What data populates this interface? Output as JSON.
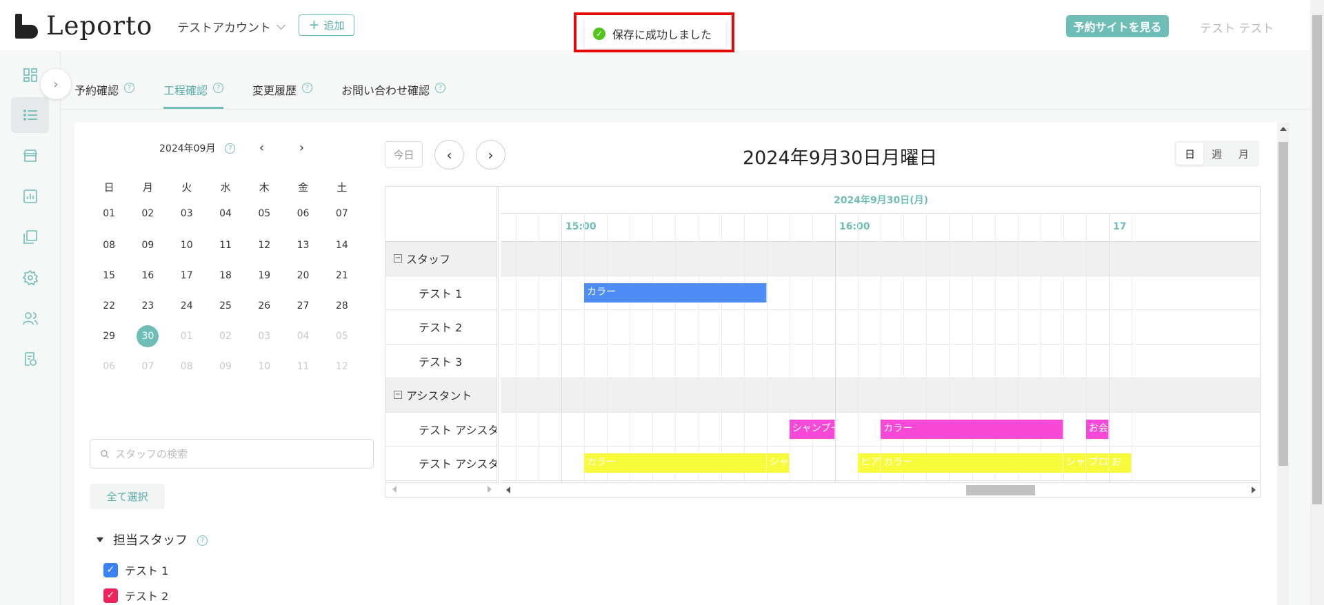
{
  "header": {
    "logo_text": "Leporto",
    "account_name": "テストアカウント",
    "add_label": "追加",
    "toast_message": "保存に成功しました",
    "view_site_label": "予約サイトを見る",
    "user_name": "テスト テスト"
  },
  "sidebar": {
    "items": [
      {
        "icon": "dashboard-icon",
        "active": false
      },
      {
        "icon": "list-icon",
        "active": true
      },
      {
        "icon": "store-icon",
        "active": false
      },
      {
        "icon": "report-chart-icon",
        "active": false
      },
      {
        "icon": "copy-pages-icon",
        "active": false
      },
      {
        "icon": "gear-icon",
        "active": false
      },
      {
        "icon": "users-icon",
        "active": false
      },
      {
        "icon": "invoice-icon",
        "active": false
      }
    ]
  },
  "tabs": [
    {
      "label": "予約確認",
      "active": false
    },
    {
      "label": "工程確認",
      "active": true
    },
    {
      "label": "変更履歴",
      "active": false
    },
    {
      "label": "お問い合わせ確認",
      "active": false
    }
  ],
  "calendar": {
    "month_label": "2024年09月",
    "weekdays": [
      "日",
      "月",
      "火",
      "水",
      "木",
      "金",
      "土"
    ],
    "weeks": [
      [
        "01",
        "02",
        "03",
        "04",
        "05",
        "06",
        "07"
      ],
      [
        "08",
        "09",
        "10",
        "11",
        "12",
        "13",
        "14"
      ],
      [
        "15",
        "16",
        "17",
        "18",
        "19",
        "20",
        "21"
      ],
      [
        "22",
        "23",
        "24",
        "25",
        "26",
        "27",
        "28"
      ],
      [
        "29",
        "30",
        "01",
        "02",
        "03",
        "04",
        "05"
      ],
      [
        "06",
        "07",
        "08",
        "09",
        "10",
        "11",
        "12"
      ]
    ],
    "selected": "30"
  },
  "staff_filter": {
    "search_placeholder": "スタッフの検索",
    "select_all_label": "全て選択",
    "section_title": "担当スタッフ",
    "staff": [
      {
        "name": "テスト 1",
        "color": "#3b82f6",
        "checked": true
      },
      {
        "name": "テスト 2",
        "color": "#f0245c",
        "checked": true
      }
    ]
  },
  "scheduler": {
    "today_label": "今日",
    "title": "2024年9月30日月曜日",
    "views": [
      {
        "label": "日",
        "active": true
      },
      {
        "label": "週",
        "active": false
      },
      {
        "label": "月",
        "active": false
      }
    ],
    "date_header": "2024年9月30日(月)",
    "hours": [
      "15:00",
      "16:00",
      "17"
    ],
    "rows": [
      {
        "label": "スタッフ",
        "group": true
      },
      {
        "label": "テスト 1",
        "group": false
      },
      {
        "label": "テスト 2",
        "group": false
      },
      {
        "label": "テスト 3",
        "group": false
      },
      {
        "label": "アシスタント",
        "group": true
      },
      {
        "label": "テスト アシスタ",
        "group": false
      },
      {
        "label": "テスト アシスタ",
        "group": false
      }
    ],
    "events": [
      {
        "row": 1,
        "start": "15:05",
        "end": "15:45",
        "label": "カラー",
        "color": "blue"
      },
      {
        "row": 5,
        "start": "15:50",
        "end": "16:00",
        "label": "シャンプー",
        "color": "pink"
      },
      {
        "row": 5,
        "start": "16:10",
        "end": "16:50",
        "label": "カラー",
        "color": "pink"
      },
      {
        "row": 5,
        "start": "16:55",
        "end": "17:00",
        "label": "お会計",
        "color": "pink"
      },
      {
        "row": 6,
        "start": "15:05",
        "end": "15:45",
        "label": "カラー",
        "color": "yellow"
      },
      {
        "row": 6,
        "start": "15:45",
        "end": "15:50",
        "label": "シャ",
        "color": "yellow"
      },
      {
        "row": 6,
        "start": "16:05",
        "end": "16:10",
        "label": "ヒア",
        "color": "yellow"
      },
      {
        "row": 6,
        "start": "16:10",
        "end": "16:50",
        "label": "カラー",
        "color": "yellow"
      },
      {
        "row": 6,
        "start": "16:50",
        "end": "16:55",
        "label": "シャ",
        "color": "yellow"
      },
      {
        "row": 6,
        "start": "16:55",
        "end": "17:00",
        "label": "ブロ",
        "color": "yellow"
      },
      {
        "row": 6,
        "start": "17:00",
        "end": "17:05",
        "label": "お",
        "color": "yellow"
      }
    ]
  }
}
